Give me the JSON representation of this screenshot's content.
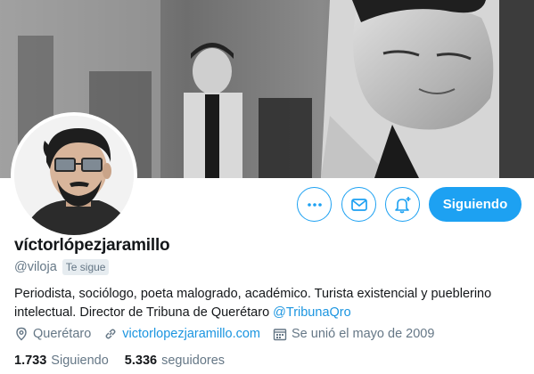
{
  "profile": {
    "display_name": "víctorlópezjaramillo",
    "handle": "@viloja",
    "follows_you_badge": "Te sigue",
    "bio_text": "Periodista, sociólogo, poeta malogrado, académico. Turista existencial y pueblerino intelectual. Director de Tribuna de Querétaro ",
    "bio_mention": "@TribunaQro",
    "location": "Querétaro",
    "website": "victorlopezjaramillo.com",
    "joined": "Se unió el mayo de 2009"
  },
  "actions": {
    "more_icon": "ellipsis-icon",
    "mail_icon": "envelope-icon",
    "notify_icon": "bell-plus-icon",
    "follow_label": "Siguiendo"
  },
  "stats": {
    "following_count": "1.733",
    "following_label": "Siguiendo",
    "followers_count": "5.336",
    "followers_label": "seguidores"
  },
  "colors": {
    "accent": "#1da1f2",
    "link": "#1b95e0",
    "secondary_text": "#657786"
  }
}
